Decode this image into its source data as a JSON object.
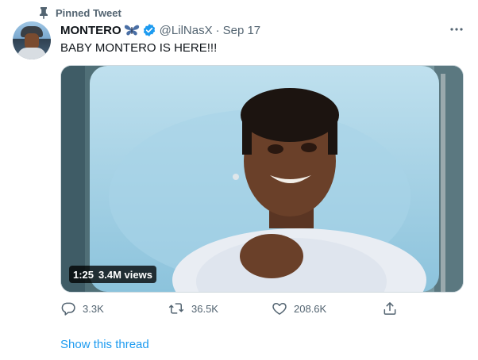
{
  "pinned_label": "Pinned Tweet",
  "tweet": {
    "display_name": "MONTERO",
    "handle": "@LilNasX",
    "separator": "·",
    "date": "Sep 17",
    "text": "BABY MONTERO IS HERE!!!",
    "media": {
      "duration": "1:25",
      "views": "3.4M views"
    },
    "actions": {
      "replies": "3.3K",
      "retweets": "36.5K",
      "likes": "208.6K"
    },
    "show_thread": "Show this thread"
  },
  "colors": {
    "link_blue": "#1d9bf0",
    "muted_gray": "#536471",
    "butterfly_blue": "#4a6fa5",
    "verified_blue": "#1d9bf0"
  }
}
